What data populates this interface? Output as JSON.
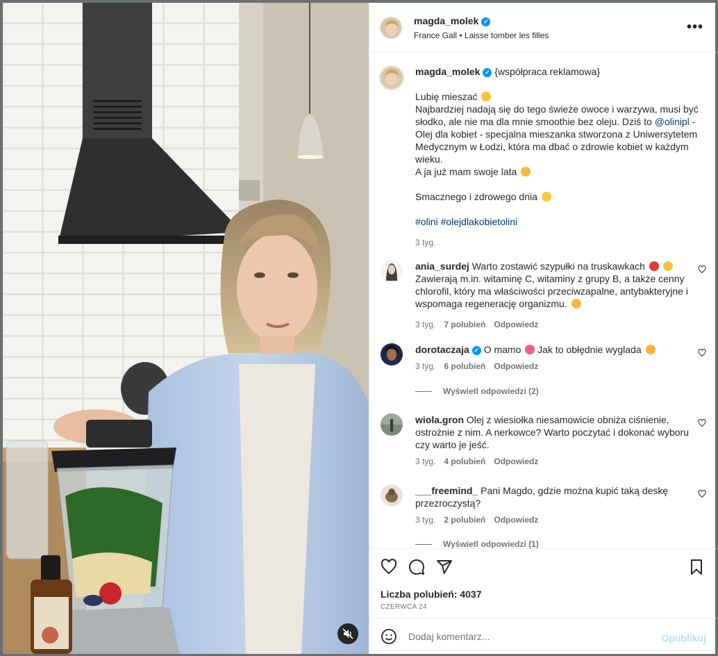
{
  "header": {
    "username": "magda_molek",
    "music": "France Gall • Laisse tomber les filles",
    "more_icon": "more-horizontal-icon"
  },
  "caption": {
    "username": "magda_molek",
    "tag": "{współpraca reklamowa}",
    "line1": "Lubię mieszać",
    "line2a": "Najbardziej nadają się do tego świeże owoce i warzywa, musi być słodko, ale nie ma dla mnie smoothie bez oleju. Dziś to ",
    "mention": "@olinipl",
    "line2b": " - Olej dla kobiet - specjalna mieszanka stworzona z Uniwersytetem Medycznym w Łodzi, która ma dbać o zdrowie kobiet w każdym wieku.",
    "line3": "A ja już mam swoje lata",
    "line4": "Smacznego i zdrowego dnia",
    "hashtags": "#olini #olejdlakobietolini",
    "time": "3 tyg."
  },
  "comments": [
    {
      "username": "ania_surdej",
      "text": "Warto zostawić szypułki na truskawkach",
      "text2": "Zawierają m.in. witaminę C, witaminy z grupy B, a także cenny chlorofil, który ma właściwości przeciwzapalne, antybakteryjne i wspomaga regenerację organizmu.",
      "time": "3 tyg.",
      "likes": "7 polubień",
      "reply": "Odpowiedz"
    },
    {
      "username": "dorotaczaja",
      "text": "O mamo",
      "text2": "Jak to obłędnie wyglada",
      "time": "3 tyg.",
      "likes": "6 polubień",
      "reply": "Odpowiedz",
      "view_replies": "Wyświetl odpowiedzi (2)"
    },
    {
      "username": "wiola.gron",
      "text": "Olej z wiesiołka niesamowicie obniża ciśnienie, ostrożnie z nim. A nerkowce? Warto poczytać i dokonać wyboru czy warto je jeść.",
      "time": "3 tyg.",
      "likes": "4 polubień",
      "reply": "Odpowiedz"
    },
    {
      "username": "___freemind_",
      "text": "Pani Magdo, gdzie można kupić taką deskę przezroczystą?",
      "time": "3 tyg.",
      "likes": "2 polubień",
      "reply": "Odpowiedz",
      "view_replies": "Wyświetl odpowiedzi (1)"
    }
  ],
  "actions": {
    "likes_label": "Liczba polubień: 4037",
    "date": "CZERWCA 24"
  },
  "add_comment": {
    "placeholder": "Dodaj komentarz...",
    "publish": "Opublikuj"
  },
  "colors": {
    "link": "#00376b",
    "verified": "#0095f6",
    "muted_text": "#737373",
    "publish_disabled": "#b2dffc"
  }
}
